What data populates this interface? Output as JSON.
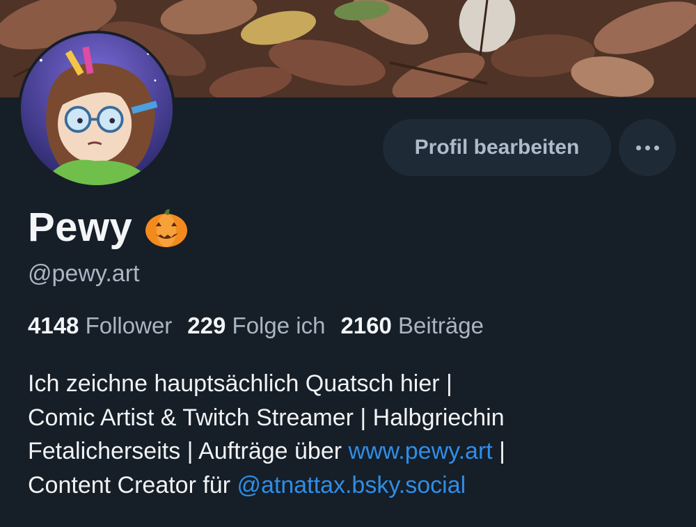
{
  "actions": {
    "edit_profile_label": "Profil bearbeiten",
    "more_icon": "ellipsis-icon"
  },
  "profile": {
    "display_name": "Pewy",
    "name_emoji": "pumpkin-icon",
    "handle": "@pewy.art"
  },
  "stats": {
    "followers_count": "4148",
    "followers_label": "Follower",
    "following_count": "229",
    "following_label": "Folge ich",
    "posts_count": "2160",
    "posts_label": "Beiträge"
  },
  "bio": {
    "line1": "Ich zeichne hauptsächlich Quatsch hier |",
    "line2": "Comic Artist & Twitch Streamer | Halbgriechin",
    "line3_text": "Fetalicherseits | Aufträge über ",
    "line3_link": "www.pewy.art",
    "line3_after": " |",
    "line4_text": "Content Creator für ",
    "line4_mention": "@atnattax.bsky.social"
  },
  "colors": {
    "background": "#161e27",
    "button_bg": "#1e2a36",
    "link": "#2e8ee8",
    "muted_text": "#aab6c3"
  }
}
